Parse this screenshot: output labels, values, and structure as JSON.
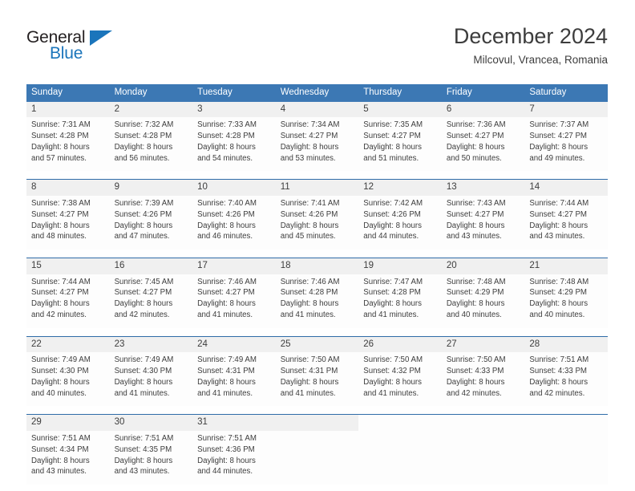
{
  "brand": {
    "name_part1": "General",
    "name_part2": "Blue",
    "accent_color": "#1b75bb"
  },
  "header": {
    "title": "December 2024",
    "location": "Milcovul, Vrancea, Romania"
  },
  "theme": {
    "header_bg": "#3c78b4",
    "daynum_bg": "#f0f0f0",
    "separator": "#2f6ca8",
    "text": "#3d3d3d"
  },
  "weekday_headers": [
    "Sunday",
    "Monday",
    "Tuesday",
    "Wednesday",
    "Thursday",
    "Friday",
    "Saturday"
  ],
  "weeks": [
    {
      "days": [
        {
          "num": "1",
          "sunrise": "Sunrise: 7:31 AM",
          "sunset": "Sunset: 4:28 PM",
          "daylight1": "Daylight: 8 hours",
          "daylight2": "and 57 minutes."
        },
        {
          "num": "2",
          "sunrise": "Sunrise: 7:32 AM",
          "sunset": "Sunset: 4:28 PM",
          "daylight1": "Daylight: 8 hours",
          "daylight2": "and 56 minutes."
        },
        {
          "num": "3",
          "sunrise": "Sunrise: 7:33 AM",
          "sunset": "Sunset: 4:28 PM",
          "daylight1": "Daylight: 8 hours",
          "daylight2": "and 54 minutes."
        },
        {
          "num": "4",
          "sunrise": "Sunrise: 7:34 AM",
          "sunset": "Sunset: 4:27 PM",
          "daylight1": "Daylight: 8 hours",
          "daylight2": "and 53 minutes."
        },
        {
          "num": "5",
          "sunrise": "Sunrise: 7:35 AM",
          "sunset": "Sunset: 4:27 PM",
          "daylight1": "Daylight: 8 hours",
          "daylight2": "and 51 minutes."
        },
        {
          "num": "6",
          "sunrise": "Sunrise: 7:36 AM",
          "sunset": "Sunset: 4:27 PM",
          "daylight1": "Daylight: 8 hours",
          "daylight2": "and 50 minutes."
        },
        {
          "num": "7",
          "sunrise": "Sunrise: 7:37 AM",
          "sunset": "Sunset: 4:27 PM",
          "daylight1": "Daylight: 8 hours",
          "daylight2": "and 49 minutes."
        }
      ]
    },
    {
      "days": [
        {
          "num": "8",
          "sunrise": "Sunrise: 7:38 AM",
          "sunset": "Sunset: 4:27 PM",
          "daylight1": "Daylight: 8 hours",
          "daylight2": "and 48 minutes."
        },
        {
          "num": "9",
          "sunrise": "Sunrise: 7:39 AM",
          "sunset": "Sunset: 4:26 PM",
          "daylight1": "Daylight: 8 hours",
          "daylight2": "and 47 minutes."
        },
        {
          "num": "10",
          "sunrise": "Sunrise: 7:40 AM",
          "sunset": "Sunset: 4:26 PM",
          "daylight1": "Daylight: 8 hours",
          "daylight2": "and 46 minutes."
        },
        {
          "num": "11",
          "sunrise": "Sunrise: 7:41 AM",
          "sunset": "Sunset: 4:26 PM",
          "daylight1": "Daylight: 8 hours",
          "daylight2": "and 45 minutes."
        },
        {
          "num": "12",
          "sunrise": "Sunrise: 7:42 AM",
          "sunset": "Sunset: 4:26 PM",
          "daylight1": "Daylight: 8 hours",
          "daylight2": "and 44 minutes."
        },
        {
          "num": "13",
          "sunrise": "Sunrise: 7:43 AM",
          "sunset": "Sunset: 4:27 PM",
          "daylight1": "Daylight: 8 hours",
          "daylight2": "and 43 minutes."
        },
        {
          "num": "14",
          "sunrise": "Sunrise: 7:44 AM",
          "sunset": "Sunset: 4:27 PM",
          "daylight1": "Daylight: 8 hours",
          "daylight2": "and 43 minutes."
        }
      ]
    },
    {
      "days": [
        {
          "num": "15",
          "sunrise": "Sunrise: 7:44 AM",
          "sunset": "Sunset: 4:27 PM",
          "daylight1": "Daylight: 8 hours",
          "daylight2": "and 42 minutes."
        },
        {
          "num": "16",
          "sunrise": "Sunrise: 7:45 AM",
          "sunset": "Sunset: 4:27 PM",
          "daylight1": "Daylight: 8 hours",
          "daylight2": "and 42 minutes."
        },
        {
          "num": "17",
          "sunrise": "Sunrise: 7:46 AM",
          "sunset": "Sunset: 4:27 PM",
          "daylight1": "Daylight: 8 hours",
          "daylight2": "and 41 minutes."
        },
        {
          "num": "18",
          "sunrise": "Sunrise: 7:46 AM",
          "sunset": "Sunset: 4:28 PM",
          "daylight1": "Daylight: 8 hours",
          "daylight2": "and 41 minutes."
        },
        {
          "num": "19",
          "sunrise": "Sunrise: 7:47 AM",
          "sunset": "Sunset: 4:28 PM",
          "daylight1": "Daylight: 8 hours",
          "daylight2": "and 41 minutes."
        },
        {
          "num": "20",
          "sunrise": "Sunrise: 7:48 AM",
          "sunset": "Sunset: 4:29 PM",
          "daylight1": "Daylight: 8 hours",
          "daylight2": "and 40 minutes."
        },
        {
          "num": "21",
          "sunrise": "Sunrise: 7:48 AM",
          "sunset": "Sunset: 4:29 PM",
          "daylight1": "Daylight: 8 hours",
          "daylight2": "and 40 minutes."
        }
      ]
    },
    {
      "days": [
        {
          "num": "22",
          "sunrise": "Sunrise: 7:49 AM",
          "sunset": "Sunset: 4:30 PM",
          "daylight1": "Daylight: 8 hours",
          "daylight2": "and 40 minutes."
        },
        {
          "num": "23",
          "sunrise": "Sunrise: 7:49 AM",
          "sunset": "Sunset: 4:30 PM",
          "daylight1": "Daylight: 8 hours",
          "daylight2": "and 41 minutes."
        },
        {
          "num": "24",
          "sunrise": "Sunrise: 7:49 AM",
          "sunset": "Sunset: 4:31 PM",
          "daylight1": "Daylight: 8 hours",
          "daylight2": "and 41 minutes."
        },
        {
          "num": "25",
          "sunrise": "Sunrise: 7:50 AM",
          "sunset": "Sunset: 4:31 PM",
          "daylight1": "Daylight: 8 hours",
          "daylight2": "and 41 minutes."
        },
        {
          "num": "26",
          "sunrise": "Sunrise: 7:50 AM",
          "sunset": "Sunset: 4:32 PM",
          "daylight1": "Daylight: 8 hours",
          "daylight2": "and 41 minutes."
        },
        {
          "num": "27",
          "sunrise": "Sunrise: 7:50 AM",
          "sunset": "Sunset: 4:33 PM",
          "daylight1": "Daylight: 8 hours",
          "daylight2": "and 42 minutes."
        },
        {
          "num": "28",
          "sunrise": "Sunrise: 7:51 AM",
          "sunset": "Sunset: 4:33 PM",
          "daylight1": "Daylight: 8 hours",
          "daylight2": "and 42 minutes."
        }
      ]
    },
    {
      "days": [
        {
          "num": "29",
          "sunrise": "Sunrise: 7:51 AM",
          "sunset": "Sunset: 4:34 PM",
          "daylight1": "Daylight: 8 hours",
          "daylight2": "and 43 minutes."
        },
        {
          "num": "30",
          "sunrise": "Sunrise: 7:51 AM",
          "sunset": "Sunset: 4:35 PM",
          "daylight1": "Daylight: 8 hours",
          "daylight2": "and 43 minutes."
        },
        {
          "num": "31",
          "sunrise": "Sunrise: 7:51 AM",
          "sunset": "Sunset: 4:36 PM",
          "daylight1": "Daylight: 8 hours",
          "daylight2": "and 44 minutes."
        },
        {
          "num": "",
          "sunrise": "",
          "sunset": "",
          "daylight1": "",
          "daylight2": ""
        },
        {
          "num": "",
          "sunrise": "",
          "sunset": "",
          "daylight1": "",
          "daylight2": ""
        },
        {
          "num": "",
          "sunrise": "",
          "sunset": "",
          "daylight1": "",
          "daylight2": ""
        },
        {
          "num": "",
          "sunrise": "",
          "sunset": "",
          "daylight1": "",
          "daylight2": ""
        }
      ]
    }
  ]
}
